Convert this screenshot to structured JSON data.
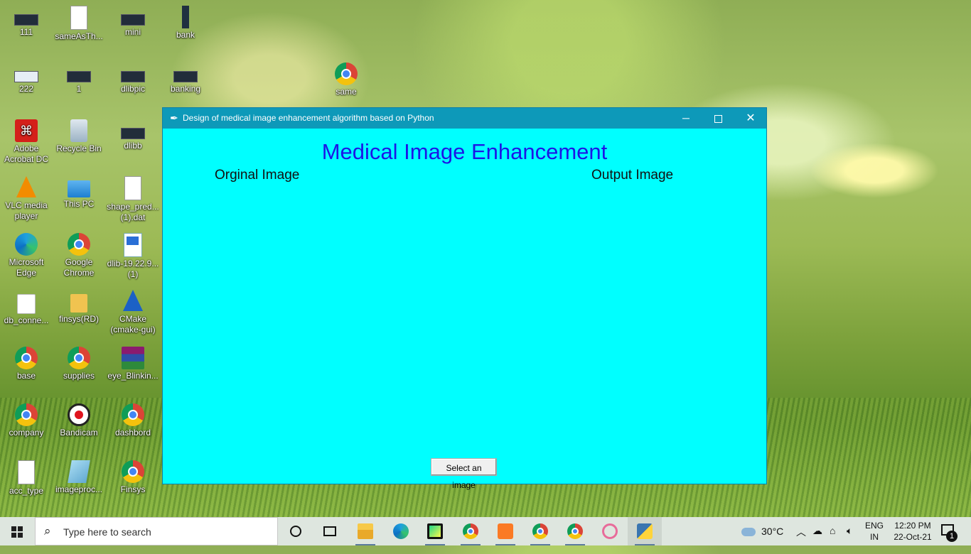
{
  "desktop": {
    "icons": [
      {
        "label": "111"
      },
      {
        "label": "sameAsTh..."
      },
      {
        "label": "mini"
      },
      {
        "label": "bank"
      },
      {
        "label": "222"
      },
      {
        "label": "1"
      },
      {
        "label": "dlibpic"
      },
      {
        "label": "banking"
      },
      {
        "label": "same"
      },
      {
        "label": "Adobe\nAcrobat DC"
      },
      {
        "label": "Recycle Bin"
      },
      {
        "label": "dlibb"
      },
      {
        "label": "VLC media\nplayer"
      },
      {
        "label": "This PC"
      },
      {
        "label": "shape_pred...\n(1).dat"
      },
      {
        "label": "Microsoft\nEdge"
      },
      {
        "label": "Google\nChrome"
      },
      {
        "label": "dlib-19.22.9...\n(1)"
      },
      {
        "label": "db_conne..."
      },
      {
        "label": "finsys(RD)"
      },
      {
        "label": "CMake\n(cmake-gui)"
      },
      {
        "label": "base"
      },
      {
        "label": "supplies"
      },
      {
        "label": "eye_Blinkin..."
      },
      {
        "label": "company"
      },
      {
        "label": "Bandicam"
      },
      {
        "label": "dashbord"
      },
      {
        "label": "acc_type"
      },
      {
        "label": "imageproc..."
      },
      {
        "label": "Finsys"
      }
    ]
  },
  "window": {
    "title": "Design of medical image enhancement algorithm based on Python",
    "heading": "Medical Image Enhancement",
    "original_label": "Orginal Image",
    "output_label": "Output Image",
    "select_button": "Select an image",
    "background": "#00ffff",
    "heading_color": "#1d16e6"
  },
  "taskbar": {
    "search_placeholder": "Type here to search",
    "temperature": "30°C",
    "lang_line1": "ENG",
    "lang_line2": "IN",
    "time": "12:20 PM",
    "date": "22-Oct-21",
    "notification_count": "1"
  }
}
